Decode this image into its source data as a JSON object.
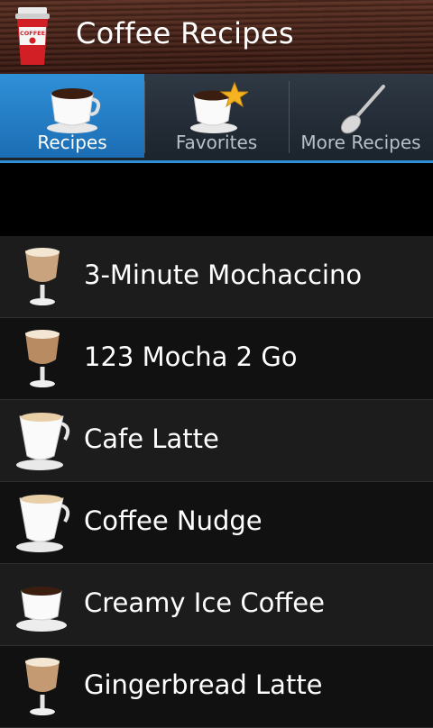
{
  "header": {
    "title": "Coffee Recipes"
  },
  "tabs": [
    {
      "label": "Recipes",
      "icon": "coffee-cup-icon",
      "active": true
    },
    {
      "label": "Favorites",
      "icon": "coffee-cup-star-icon",
      "active": false
    },
    {
      "label": "More Recipes",
      "icon": "spoon-icon",
      "active": false
    }
  ],
  "recipes": [
    {
      "name": "3-Minute Mochaccino",
      "icon": "goblet-drink-icon"
    },
    {
      "name": "123 Mocha 2 Go",
      "icon": "goblet-drink-icon"
    },
    {
      "name": "Cafe Latte",
      "icon": "latte-cup-icon"
    },
    {
      "name": "Coffee Nudge",
      "icon": "latte-cup-icon"
    },
    {
      "name": "Creamy Ice Coffee",
      "icon": "coffee-cup-icon"
    },
    {
      "name": "Gingerbread Latte",
      "icon": "goblet-drink-icon"
    }
  ],
  "colors": {
    "accent": "#2f8fd6",
    "title_wood": "#4a2418"
  }
}
